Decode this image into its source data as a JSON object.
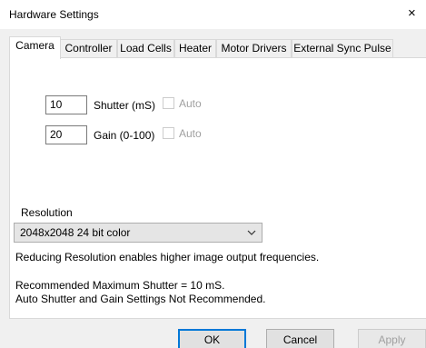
{
  "window": {
    "title": "Hardware Settings",
    "close_glyph": "×"
  },
  "tabs": [
    {
      "label": "Camera",
      "active": true
    },
    {
      "label": "Controller",
      "active": false
    },
    {
      "label": "Load Cells",
      "active": false
    },
    {
      "label": "Heater",
      "active": false
    },
    {
      "label": "Motor Drivers",
      "active": false
    },
    {
      "label": "External Sync Pulse",
      "active": false
    }
  ],
  "camera": {
    "shutter": {
      "value": "10",
      "label": "Shutter (mS)",
      "auto_label": "Auto",
      "auto_checked": false
    },
    "gain": {
      "value": "20",
      "label": "Gain (0-100)",
      "auto_label": "Auto",
      "auto_checked": false
    },
    "resolution": {
      "label": "Resolution",
      "selected": "2048x2048 24 bit color",
      "hint": "Reducing Resolution enables higher image output frequencies."
    },
    "notes": [
      "Recommended Maximum Shutter = 10 mS.",
      "Auto Shutter and Gain Settings Not Recommended."
    ]
  },
  "buttons": {
    "ok": "OK",
    "cancel": "Cancel",
    "apply": "Apply"
  },
  "icons": {
    "close": "close-icon",
    "dropdown": "chevron-down-icon"
  }
}
